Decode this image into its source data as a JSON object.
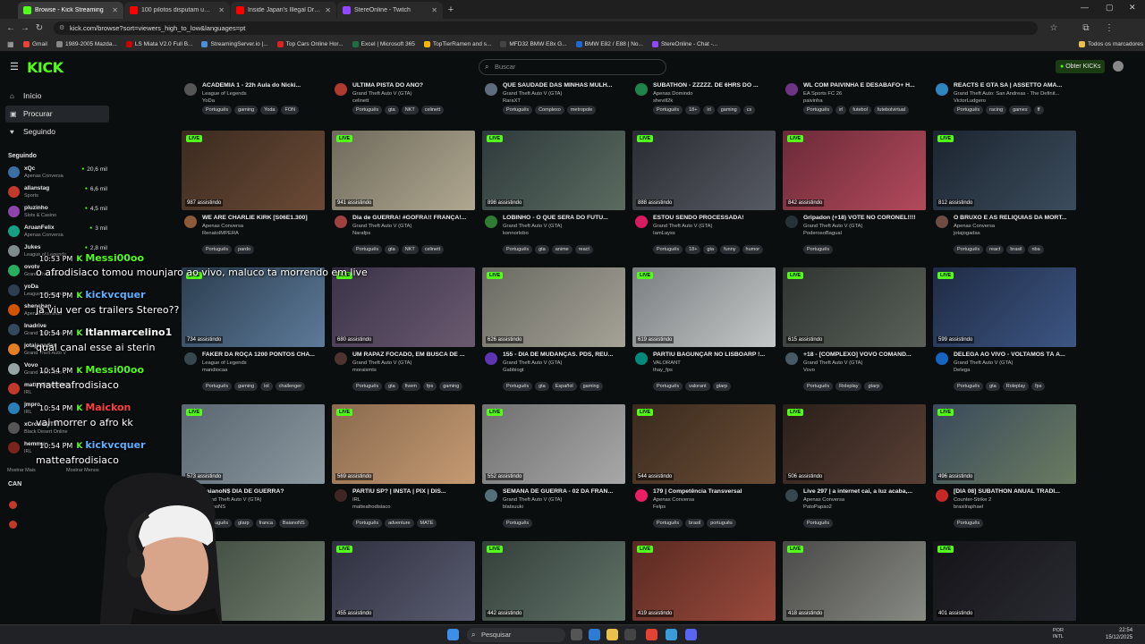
{
  "browser": {
    "tabs": [
      {
        "label": "Browse - Kick Streaming",
        "color": "#53fc18",
        "active": true
      },
      {
        "label": "100 pilotos disputam um jato p",
        "color": "#ff0000",
        "active": false
      },
      {
        "label": "Inside Japan's Illegal Drifting U",
        "color": "#ff0000",
        "active": false
      },
      {
        "label": "StereOnline - Twitch",
        "color": "#9146ff",
        "active": false
      }
    ],
    "url": "kick.com/browse?sort=viewers_high_to_low&languages=pt",
    "bookmarks": [
      {
        "label": "Gmail",
        "color": "#ea4335"
      },
      {
        "label": "1989-2005 Mazda...",
        "color": "#888"
      },
      {
        "label": "LS Miata V2.0 Full B...",
        "color": "#cc0000"
      },
      {
        "label": "StreamingServer.io |...",
        "color": "#4a90d9"
      },
      {
        "label": "Top Cars Online Hor...",
        "color": "#d22"
      },
      {
        "label": "Excel | Microsoft 365",
        "color": "#1d6f42"
      },
      {
        "label": "TopTierRamen and s...",
        "color": "#f7b500"
      },
      {
        "label": "MFD32 BMW E8x G...",
        "color": "#444"
      },
      {
        "label": "BMW E82 / E88 | No...",
        "color": "#1c69d4"
      },
      {
        "label": "StereOnline - Chat -...",
        "color": "#9146ff"
      }
    ],
    "all_bookmarks": "Todos os marcadores"
  },
  "header": {
    "logo": "KICK",
    "search_placeholder": "Buscar",
    "get_kicks": "Obter KICKs"
  },
  "sidebar": {
    "nav": [
      {
        "label": "Início",
        "icon": "home-icon",
        "glyph": "⌂"
      },
      {
        "label": "Procurar",
        "icon": "browse-icon",
        "glyph": "▣"
      },
      {
        "label": "Seguindo",
        "icon": "heart-icon",
        "glyph": "♥"
      }
    ],
    "following_heading": "Seguindo",
    "following": [
      {
        "name": "xQc",
        "category": "Apenas Conversa",
        "viewers": "20,6 mil",
        "color": "#3a6ea5"
      },
      {
        "name": "allanstag",
        "category": "Sports",
        "viewers": "6,6 mil",
        "color": "#c0392b"
      },
      {
        "name": "pluzinho",
        "category": "Slots & Casino",
        "viewers": "4,5 mil",
        "color": "#8e44ad"
      },
      {
        "name": "AruanFelix",
        "category": "Apenas Conversa",
        "viewers": "3 mil",
        "color": "#16a085"
      },
      {
        "name": "Jukes",
        "category": "League of Legends",
        "viewers": "2,8 mil",
        "color": "#7f8c8d"
      },
      {
        "name": "ovotv",
        "category": "Grand Theft Auto V",
        "viewers": "",
        "color": "#27ae60"
      },
      {
        "name": "yoDa",
        "category": "League of Legends",
        "viewers": "",
        "color": "#2c3e50"
      },
      {
        "name": "shenehan",
        "category": "Apenas Domindo",
        "viewers": "",
        "color": "#d35400"
      },
      {
        "name": "Inadrive",
        "category": "Grand Theft Auto V",
        "viewers": "",
        "color": "#34495e"
      },
      {
        "name": "jotajogadas",
        "category": "Grand Theft Auto V",
        "viewers": "",
        "color": "#e67e22"
      },
      {
        "name": "Vovo",
        "category": "Grand Theft Auto V",
        "viewers": "",
        "color": "#95a5a6"
      },
      {
        "name": "matteafrodisiaco",
        "category": "IRL",
        "viewers": "",
        "color": "#c0392b"
      },
      {
        "name": "jmpro",
        "category": "IRL",
        "viewers": "",
        "color": "#2980b9"
      },
      {
        "name": "xCrowleyTV",
        "category": "Black Desert Online",
        "viewers": "",
        "color": "#555"
      },
      {
        "name": "hemmy",
        "category": "IRL",
        "viewers": "",
        "color": "#7b241c"
      }
    ],
    "show_more": "Mostrar Mais",
    "show_less": "Mostrar Menos",
    "channels_heading": "CAN"
  },
  "top_row": [
    {
      "title": "ACADEMIA 1 - 22h Aula do Nicki...",
      "category": "League of Legends",
      "name": "YoDa",
      "tags": [
        "Português",
        "gaming",
        "Yoda",
        "FON"
      ],
      "avatar": "#555"
    },
    {
      "title": "ÚLTIMA PISTA DO ANO?",
      "category": "Grand Theft Auto V (GTA)",
      "name": "celinett",
      "tags": [
        "Português",
        "gta",
        "NKT",
        "celinett"
      ],
      "avatar": "#b03a2e"
    },
    {
      "title": "QUE SAUDADE DAS MINHAS MULH...",
      "category": "Grand Theft Auto V (GTA)",
      "name": "RaraXT",
      "tags": [
        "Português",
        "Complexo",
        "metropole"
      ],
      "avatar": "#5d6d7e"
    },
    {
      "title": "SUBATHON - ZZZZZ. DE 6HRS DO ...",
      "category": "Apenas Domindo",
      "name": "shevill2k",
      "tags": [
        "Português",
        "18+",
        "irl",
        "gaming",
        "cs"
      ],
      "avatar": "#1e8449"
    },
    {
      "title": "WL COM PAIVINHA E DESABAFO+ H...",
      "category": "EA Sports FC 26",
      "name": "paivinha",
      "tags": [
        "Português",
        "irl",
        "futebol",
        "futebolvirtual"
      ],
      "avatar": "#6c3483"
    },
    {
      "title": "REACTS E GTA SA | ASSETTO AMA...",
      "category": "Grand Theft Auto: San Andreas - The Definit...",
      "name": "VictorLudgero",
      "tags": [
        "Português",
        "racing",
        "games",
        "ff"
      ],
      "avatar": "#2e86c1"
    }
  ],
  "streams": [
    {
      "viewers": "987 assistindo",
      "title": "WE ARE CHARLIE KIRK [S06E1.300]",
      "category": "Apenas Conversa",
      "name": "RenatoIMPERA",
      "tags": [
        "Português",
        "pardo"
      ],
      "thumb": [
        "#3b2b20",
        "#6b4a35"
      ],
      "avatar": "#8e5b3a"
    },
    {
      "viewers": "941 assistindo",
      "title": "Dia de GUERRA! #GOFRA!! FRANÇA!...",
      "category": "Grand Theft Auto V (GTA)",
      "name": "Narafps",
      "tags": [
        "Português",
        "gta",
        "NKT",
        "celinett"
      ],
      "thumb": [
        "#6f6a5c",
        "#b0a890"
      ],
      "avatar": "#a04040"
    },
    {
      "viewers": "898 assistindo",
      "title": "LOBINHO - O QUE SERÁ DO FUTU...",
      "category": "Grand Theft Auto V (GTA)",
      "name": "konnorlobo",
      "tags": [
        "Português",
        "gta",
        "anime",
        "react"
      ],
      "thumb": [
        "#2e3a3c",
        "#5b6b60"
      ],
      "avatar": "#2e7d32"
    },
    {
      "viewers": "888 assistindo",
      "title": "ESTOU SENDO PROCESSADA!",
      "category": "Grand Theft Auto V (GTA)",
      "name": "IamLayss",
      "tags": [
        "Português",
        "18+",
        "gta",
        "funny",
        "humor"
      ],
      "thumb": [
        "#2a2d33",
        "#565a63"
      ],
      "avatar": "#d81b60"
    },
    {
      "viewers": "842 assistindo",
      "title": "Gripadon (+18) VOTE NO CORONEL!!!!",
      "category": "Grand Theft Auto V (GTA)",
      "name": "PoderosoBagual",
      "tags": [
        "Português"
      ],
      "thumb": [
        "#6b2a38",
        "#b24a5c"
      ],
      "avatar": "#263238"
    },
    {
      "viewers": "812 assistindo",
      "title": "O BRUXO E AS RELIQUIAS DA MORT...",
      "category": "Apenas Conversa",
      "name": "jotajogadas",
      "tags": [
        "Português",
        "react",
        "brasil",
        "nba"
      ],
      "thumb": [
        "#1c2530",
        "#3b4c5c"
      ],
      "avatar": "#6d4c41"
    },
    {
      "viewers": "734 assistindo",
      "title": "FAKER DA ROÇA 1200 PONTOS CHA...",
      "category": "League of Legends",
      "name": "mandiocaa",
      "tags": [
        "Português",
        "gaming",
        "lol",
        "challenger"
      ],
      "thumb": [
        "#2c3e50",
        "#5d7a99"
      ],
      "avatar": "#37474f"
    },
    {
      "viewers": "680 assistindo",
      "title": "UM RAPAZ FOCADO, EM BUSCA DE ...",
      "category": "Grand Theft Auto V (GTA)",
      "name": "moraismts",
      "tags": [
        "Português",
        "gta",
        "fivem",
        "fps",
        "gaming"
      ],
      "thumb": [
        "#3b3348",
        "#6a5a70"
      ],
      "avatar": "#4e342e"
    },
    {
      "viewers": "626 assistindo",
      "title": "155 - DIA DE MUDANÇAS. PDS, REU...",
      "category": "Grand Theft Auto V (GTA)",
      "name": "Gabbiogt",
      "tags": [
        "Português",
        "gta",
        "Español",
        "gaming"
      ],
      "thumb": [
        "#6a6a62",
        "#a5a297"
      ],
      "avatar": "#5e35b1"
    },
    {
      "viewers": "619 assistindo",
      "title": "PARTIU BAGUNÇAR NO LISBOARP !...",
      "category": "VALORANT",
      "name": "thay_fps",
      "tags": [
        "Português",
        "valorant",
        "gtarp"
      ],
      "thumb": [
        "#7a7e80",
        "#c5c8c9"
      ],
      "avatar": "#00897b"
    },
    {
      "viewers": "615 assistindo",
      "title": "+18 - [COMPLEXO] VOVO COMAND...",
      "category": "Grand Theft Auto V (GTA)",
      "name": "Vovo",
      "tags": [
        "Português",
        "Roleplay",
        "gtarp"
      ],
      "thumb": [
        "#2f3430",
        "#59615a"
      ],
      "avatar": "#455a64"
    },
    {
      "viewers": "599 assistindo",
      "title": "DELEGA AO VIVO - VOLTAMOS TÁ A...",
      "category": "Grand Theft Auto V (GTA)",
      "name": "Delega",
      "tags": [
        "Português",
        "gta",
        "Roleplay",
        "fps"
      ],
      "thumb": [
        "#1f2b44",
        "#3d5684"
      ],
      "avatar": "#1565c0"
    },
    {
      "viewers": "573 assistindo",
      "title": "BaianoN$ DIA DE GUERRA?",
      "category": "Grand Theft Auto V (GTA)",
      "name": "BaianoNS",
      "tags": [
        "Português",
        "gtarp",
        "franca",
        "BaianoNS"
      ],
      "thumb": [
        "#5a6670",
        "#8c98a0"
      ],
      "avatar": "#795548"
    },
    {
      "viewers": "569 assistindo",
      "title": "PARTIU SP? | INSTA | PIX | DIS...",
      "category": "IRL",
      "name": "matteafrodisiaco",
      "tags": [
        "Português",
        "adventure",
        "MATE"
      ],
      "thumb": [
        "#8a6a4e",
        "#c59a72"
      ],
      "avatar": "#3e2723"
    },
    {
      "viewers": "552 assistindo",
      "title": "SEMANA DE GUERRA - 02 DA FRAN...",
      "category": "Grand Theft Auto V (GTA)",
      "name": "blatsuuki",
      "tags": [
        "Português"
      ],
      "thumb": [
        "#707070",
        "#a8a8a8"
      ],
      "avatar": "#546e7a"
    },
    {
      "viewers": "544 assistindo",
      "title": "179 | Competência Transversal",
      "category": "Apenas Conversa",
      "name": "Felps",
      "tags": [
        "Português",
        "brasil",
        "português"
      ],
      "thumb": [
        "#3a2a1e",
        "#6b4d36"
      ],
      "avatar": "#e91e63"
    },
    {
      "viewers": "506 assistindo",
      "title": "Live 297 | a internet cai, a luz acaba,...",
      "category": "Apenas Conversa",
      "name": "PatoPapao2",
      "tags": [
        "Português"
      ],
      "thumb": [
        "#2a1f1a",
        "#5a4035"
      ],
      "avatar": "#37474f"
    },
    {
      "viewers": "496 assistindo",
      "title": "[DIA 08] SUBATHON ANUAL TRADI...",
      "category": "Counter-Strike 2",
      "name": "brasilraphael",
      "tags": [
        "Português"
      ],
      "thumb": [
        "#3a4a5c",
        "#6a7c60"
      ],
      "avatar": "#c62828"
    },
    {
      "viewers": "",
      "title": "",
      "category": "",
      "name": "",
      "tags": [],
      "thumb": [
        "#3e4a3e",
        "#6e7a6a"
      ],
      "avatar": ""
    },
    {
      "viewers": "455 assistindo",
      "title": "",
      "category": "",
      "name": "",
      "tags": [],
      "thumb": [
        "#2f3140",
        "#595c70"
      ],
      "avatar": ""
    },
    {
      "viewers": "442 assistindo",
      "title": "",
      "category": "",
      "name": "",
      "tags": [],
      "thumb": [
        "#34403a",
        "#607268"
      ],
      "avatar": ""
    },
    {
      "viewers": "419 assistindo",
      "title": "",
      "category": "",
      "name": "",
      "tags": [],
      "thumb": [
        "#5a2a22",
        "#9a4a3c"
      ],
      "avatar": ""
    },
    {
      "viewers": "418 assistindo",
      "title": "",
      "category": "",
      "name": "",
      "tags": [],
      "thumb": [
        "#4a4a48",
        "#888a84"
      ],
      "avatar": ""
    },
    {
      "viewers": "401 assistindo",
      "title": "",
      "category": "",
      "name": "",
      "tags": [],
      "thumb": [
        "#141418",
        "#2a2a32"
      ],
      "avatar": ""
    }
  ],
  "chat": [
    {
      "time": "10:53 PM",
      "user": "Messi00oo",
      "user_color": "#53fc18",
      "message": ""
    },
    {
      "time": "",
      "user": "",
      "user_color": "",
      "message": "o afrodisiaco tomou mounjaro ao vivo, maluco ta morrendo em live"
    },
    {
      "time": "10:54 PM",
      "user": "kickvcquer",
      "user_color": "#5fb0ff",
      "message": ""
    },
    {
      "time": "",
      "user": "",
      "user_color": "",
      "message": "já viu ver os trailers Stereo??"
    },
    {
      "time": "10:54 PM",
      "user": "ltlanmarcelino1",
      "user_color": "#ffffff",
      "message": ""
    },
    {
      "time": "",
      "user": "",
      "user_color": "",
      "message": "qual canal esse ai sterin"
    },
    {
      "time": "10:54 PM",
      "user": "Messi00oo",
      "user_color": "#53fc18",
      "message": ""
    },
    {
      "time": "",
      "user": "",
      "user_color": "",
      "message": "matteafrodisiaco"
    },
    {
      "time": "10:54 PM",
      "user": "Maickon",
      "user_color": "#ff4040",
      "message": ""
    },
    {
      "time": "",
      "user": "",
      "user_color": "",
      "message": "vai morrer o afro kk"
    },
    {
      "time": "10:54 PM",
      "user": "kickvcquer",
      "user_color": "#5fb0ff",
      "message": ""
    },
    {
      "time": "",
      "user": "",
      "user_color": "",
      "message": "matteafrodisiaco"
    }
  ],
  "taskbar": {
    "search": "Pesquisar",
    "lang1": "POR",
    "lang2": "INTL",
    "time": "22:54",
    "date": "15/12/2025"
  }
}
